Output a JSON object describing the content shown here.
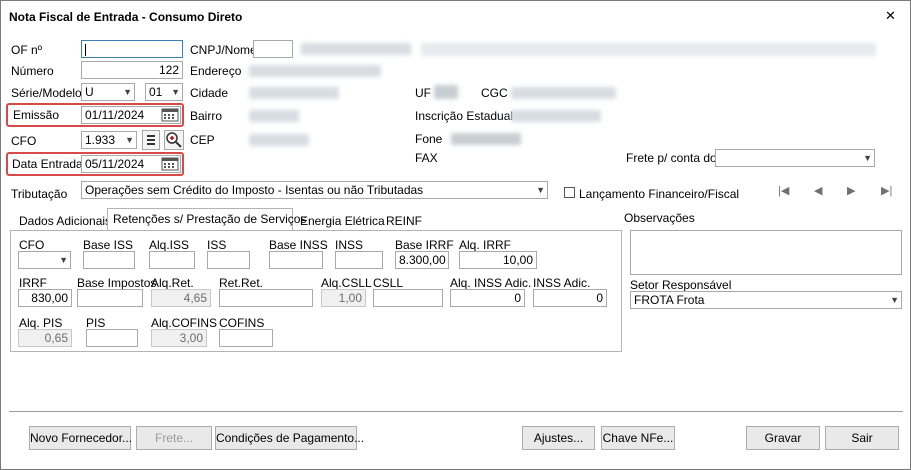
{
  "window": {
    "title": "Nota Fiscal de Entrada - Consumo Direto",
    "close": "✕"
  },
  "labels": {
    "of": "OF nº",
    "numero": "Número",
    "serie_modelo": "Série/Modelo",
    "emissao": "Emissão",
    "cfo": "CFO",
    "data_entrada": "Data Entrada",
    "cnpj_nome": "CNPJ/Nome",
    "endereco": "Endereço",
    "cidade": "Cidade",
    "bairro": "Bairro",
    "cep": "CEP",
    "uf": "UF",
    "cgc": "CGC",
    "inscricao": "Inscrição Estadual",
    "fone": "Fone",
    "fax": "FAX",
    "frete_conta": "Frete p/ conta do",
    "tributacao": "Tributação",
    "lancamento": "Lançamento Financeiro/Fiscal",
    "observacoes": "Observações",
    "setor": "Setor Responsável"
  },
  "fields": {
    "numero": "122",
    "serie": "U",
    "modelo": "01",
    "emissao": "01/11/2024",
    "cfo": "1.933",
    "data_entrada": "05/11/2024",
    "tributacao": "Operações sem Crédito do Imposto - Isentas ou não Tributadas",
    "setor": "FROTA Frota"
  },
  "tabs": [
    "Dados Adicionais",
    "Retenções s/ Prestação de Serviços",
    "Energia Elétrica",
    "REINF"
  ],
  "ret": {
    "cfo": "CFO",
    "base_iss": "Base ISS",
    "aliq_iss": "Alq.ISS",
    "iss": "ISS",
    "base_inss": "Base INSS",
    "inss": "INSS",
    "base_irrf": "Base IRRF",
    "aliq_irrf": "Alq. IRRF",
    "irrf": "IRRF",
    "base_impostos": "Base Impostos",
    "aliq_ret": "Alq.Ret.",
    "ret_ret": "Ret.Ret.",
    "aliq_csll": "Alq.CSLL",
    "csll": "CSLL",
    "aliq_inss_adic": "Alq. INSS Adic.",
    "inss_adic": "INSS Adic.",
    "aliq_pis": "Alq. PIS",
    "pis": "PIS",
    "aliq_cofins": "Alq.COFINS",
    "cofins": "COFINS",
    "v_base_irrf": "8.300,00",
    "v_aliq_irrf": "10,00",
    "v_irrf": "830,00",
    "v_aliq_ret": "4,65",
    "v_aliq_csll": "1,00",
    "v_aliq_inss_adic": "0",
    "v_inss_adic": "0",
    "v_aliq_pis": "0,65",
    "v_aliq_cofins": "3,00"
  },
  "buttons": {
    "novo_fornecedor": "Novo Fornecedor...",
    "frete": "Frete...",
    "condicoes": "Condições de Pagamento...",
    "ajustes": "Ajustes...",
    "chave": "Chave NFe...",
    "gravar": "Gravar",
    "sair": "Sair"
  },
  "colors": {
    "highlight": "#d84a4a",
    "border": "#a9a9a9"
  }
}
